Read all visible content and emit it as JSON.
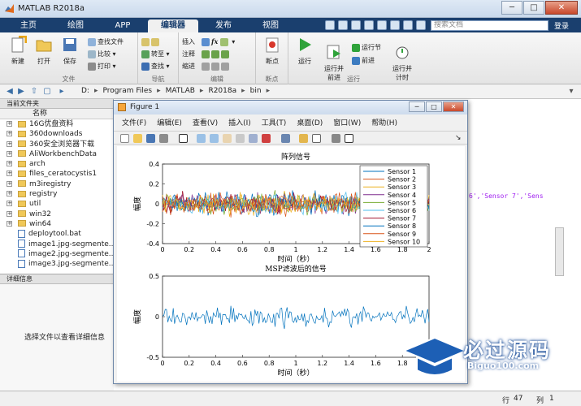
{
  "window": {
    "title": "MATLAB R2018a",
    "min": "─",
    "max": "□",
    "close": "✕"
  },
  "tabs": [
    "主页",
    "绘图",
    "APP",
    "编辑器",
    "发布",
    "视图"
  ],
  "active_tab": "编辑器",
  "search": {
    "placeholder": "搜索文档"
  },
  "login": "登录",
  "ribbon": {
    "file": {
      "label": "文件",
      "new": "新建",
      "open": "打开",
      "save": "保存",
      "find_files": "查找文件",
      "compare": "比较",
      "print": "打印"
    },
    "nav": {
      "label": "导航",
      "goto": "转至",
      "find": "查找"
    },
    "edit": {
      "label": "编辑",
      "insert": "插入",
      "comment": "注释",
      "indent": "缩进",
      "fx": "fx"
    },
    "breakpoints": {
      "label": "断点",
      "btn": "断点"
    },
    "run": {
      "label": "运行",
      "run": "运行",
      "run_advance": "运行并\n前进",
      "run_section": "运行节",
      "advance": "前进",
      "run_time": "运行并\n计时"
    }
  },
  "address": {
    "crumbs": [
      "D:",
      "Program Files",
      "MATLAB",
      "R2018a",
      "bin"
    ]
  },
  "current_folder": {
    "header": "当前文件夹",
    "col_name": "名称",
    "items": [
      {
        "name": "16G优盘资料",
        "type": "folder"
      },
      {
        "name": "360downloads",
        "type": "folder"
      },
      {
        "name": "360安全浏览器下载",
        "type": "folder"
      },
      {
        "name": "AliWorkbenchData",
        "type": "folder"
      },
      {
        "name": "arch",
        "type": "folder"
      },
      {
        "name": "files_ceratocystis1",
        "type": "folder"
      },
      {
        "name": "m3iregistry",
        "type": "folder"
      },
      {
        "name": "registry",
        "type": "folder"
      },
      {
        "name": "util",
        "type": "folder"
      },
      {
        "name": "win32",
        "type": "folder"
      },
      {
        "name": "win64",
        "type": "folder"
      },
      {
        "name": "deploytool.bat",
        "type": "file"
      },
      {
        "name": "image1.jpg-segmente...",
        "type": "file"
      },
      {
        "name": "image2.jpg-segmente...",
        "type": "file"
      },
      {
        "name": "image3.jpg-segmente...",
        "type": "file"
      }
    ]
  },
  "details": {
    "header": "详细信息",
    "hint": "选择文件以查看详细信息"
  },
  "editor": {
    "code_fragment": "6','Sensor 7','Sens"
  },
  "statusbar": {
    "row_label": "行",
    "row": "47",
    "col_label": "列",
    "col": "1"
  },
  "figure": {
    "title": "Figure 1",
    "menu": [
      "文件(F)",
      "编辑(E)",
      "查看(V)",
      "插入(I)",
      "工具(T)",
      "桌面(D)",
      "窗口(W)",
      "帮助(H)"
    ]
  },
  "watermark": {
    "text": "必过源码",
    "url": "Biguo100.com"
  },
  "chart_data": [
    {
      "type": "line",
      "title": "阵列信号",
      "xlabel": "时间（秒）",
      "ylabel": "幅度",
      "xlim": [
        0,
        2
      ],
      "ylim": [
        -0.4,
        0.4
      ],
      "xticks": [
        "0",
        "0.2",
        "0.4",
        "0.6",
        "0.8",
        "1",
        "1.2",
        "1.4",
        "1.6",
        "1.8",
        "2"
      ],
      "yticks": [
        "0.4",
        "0.2",
        "0",
        "-0.2",
        "-0.4"
      ],
      "legend_position": "top-right",
      "series": [
        {
          "name": "Sensor 1",
          "color": "#0072BD"
        },
        {
          "name": "Sensor 2",
          "color": "#D95319"
        },
        {
          "name": "Sensor 3",
          "color": "#EDB120"
        },
        {
          "name": "Sensor 4",
          "color": "#7E2F8E"
        },
        {
          "name": "Sensor 5",
          "color": "#77AC30"
        },
        {
          "name": "Sensor 6",
          "color": "#4DBEEE"
        },
        {
          "name": "Sensor 7",
          "color": "#A2142F"
        },
        {
          "name": "Sensor 8",
          "color": "#0072BD"
        },
        {
          "name": "Sensor 9",
          "color": "#D95319"
        },
        {
          "name": "Sensor 10",
          "color": "#EDB120"
        }
      ],
      "signal_amplitude": 0.15
    },
    {
      "type": "line",
      "title": "MSP滤波后的信号",
      "xlabel": "时间（秒）",
      "ylabel": "幅度",
      "xlim": [
        0,
        2
      ],
      "ylim": [
        -0.5,
        0.5
      ],
      "xticks": [
        "0",
        "0.2",
        "0.4",
        "0.6",
        "0.8",
        "1",
        "1.2",
        "1.4",
        "1.6",
        "1.8",
        "2"
      ],
      "yticks": [
        "0.5",
        "0",
        "-0.5"
      ],
      "series": [
        {
          "color": "#0072BD"
        }
      ],
      "signal_amplitude": 0.18
    }
  ]
}
